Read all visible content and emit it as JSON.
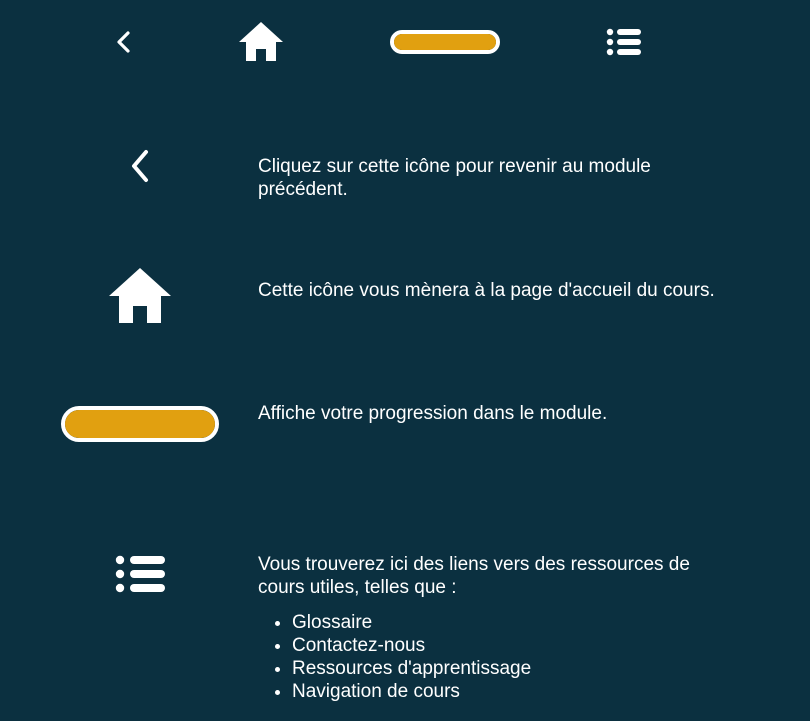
{
  "topbar": {
    "back_icon": "chevron-left-icon",
    "home_icon": "home-icon",
    "progress_bar": {
      "fill_percent": 100,
      "fill_color": "#e1a010",
      "border_color": "#ffffff"
    },
    "menu_icon": "list-icon"
  },
  "help": {
    "items": [
      {
        "icon": "chevron-left-icon",
        "text": "Cliquez sur cette icône pour revenir au module précédent."
      },
      {
        "icon": "home-icon",
        "text": "Cette icône vous mènera à la page d'accueil du cours."
      },
      {
        "icon": "progress-bar",
        "text": "Affiche votre progression dans le module."
      },
      {
        "icon": "list-icon",
        "text": "Vous trouverez ici des liens vers des ressources de cours utiles, telles que :",
        "bullets": [
          "Glossaire",
          "Contactez-nous",
          "Ressources d'apprentissage",
          "Navigation de cours"
        ]
      }
    ]
  },
  "colors": {
    "background": "#0b3040",
    "accent": "#e1a010",
    "foreground": "#ffffff"
  }
}
